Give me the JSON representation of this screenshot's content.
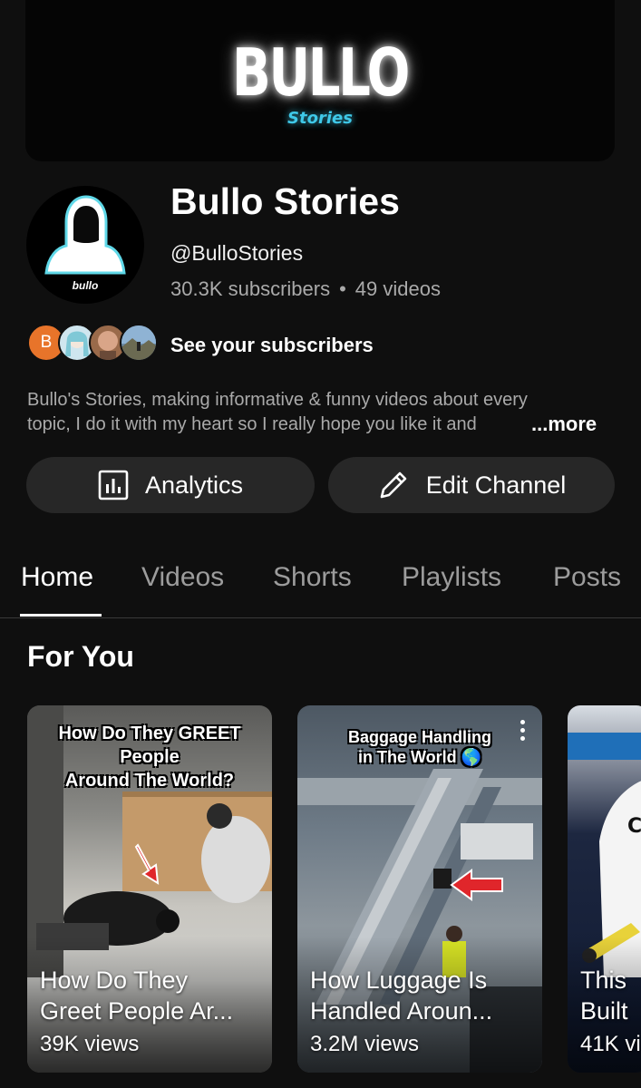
{
  "banner": {
    "title": "BULLO",
    "subtitle": "Stories"
  },
  "channel": {
    "avatar_label": "bullo",
    "name": "Bullo Stories",
    "handle": "@BulloStories",
    "subscribers": "30.3K subscribers",
    "separator": "•",
    "videos": "49 videos",
    "subscriber_avatar_initial": "B",
    "see_subscribers": "See your subscribers",
    "description_line1": "Bullo's Stories, making informative & funny videos about every",
    "description_line2": "topic, I do it with my heart so I really hope you like it and",
    "more_label": "...more"
  },
  "buttons": {
    "analytics": "Analytics",
    "edit_channel": "Edit Channel"
  },
  "tabs": [
    {
      "label": "Home"
    },
    {
      "label": "Videos"
    },
    {
      "label": "Shorts"
    },
    {
      "label": "Playlists"
    },
    {
      "label": "Posts"
    }
  ],
  "section": {
    "title": "For You"
  },
  "cards": [
    {
      "overlay_line1": "How Do They GREET People",
      "overlay_line2": "Around The World?",
      "title_line1": "How Do They",
      "title_line2": "Greet People Ar...",
      "views": "39K views"
    },
    {
      "overlay_line1": "Baggage Handling",
      "overlay_line2": "in The World 🌎",
      "title_line1": "How Luggage Is",
      "title_line2": "Handled Aroun...",
      "views": "3.2M views"
    },
    {
      "title_line1": "This",
      "title_line2": "Built",
      "views": "41K vi"
    }
  ],
  "colors": {
    "background": "#0f0f0f",
    "button_bg": "#272727",
    "secondary_text": "#aaaaaa",
    "banner_accent": "#3fc8e8"
  }
}
